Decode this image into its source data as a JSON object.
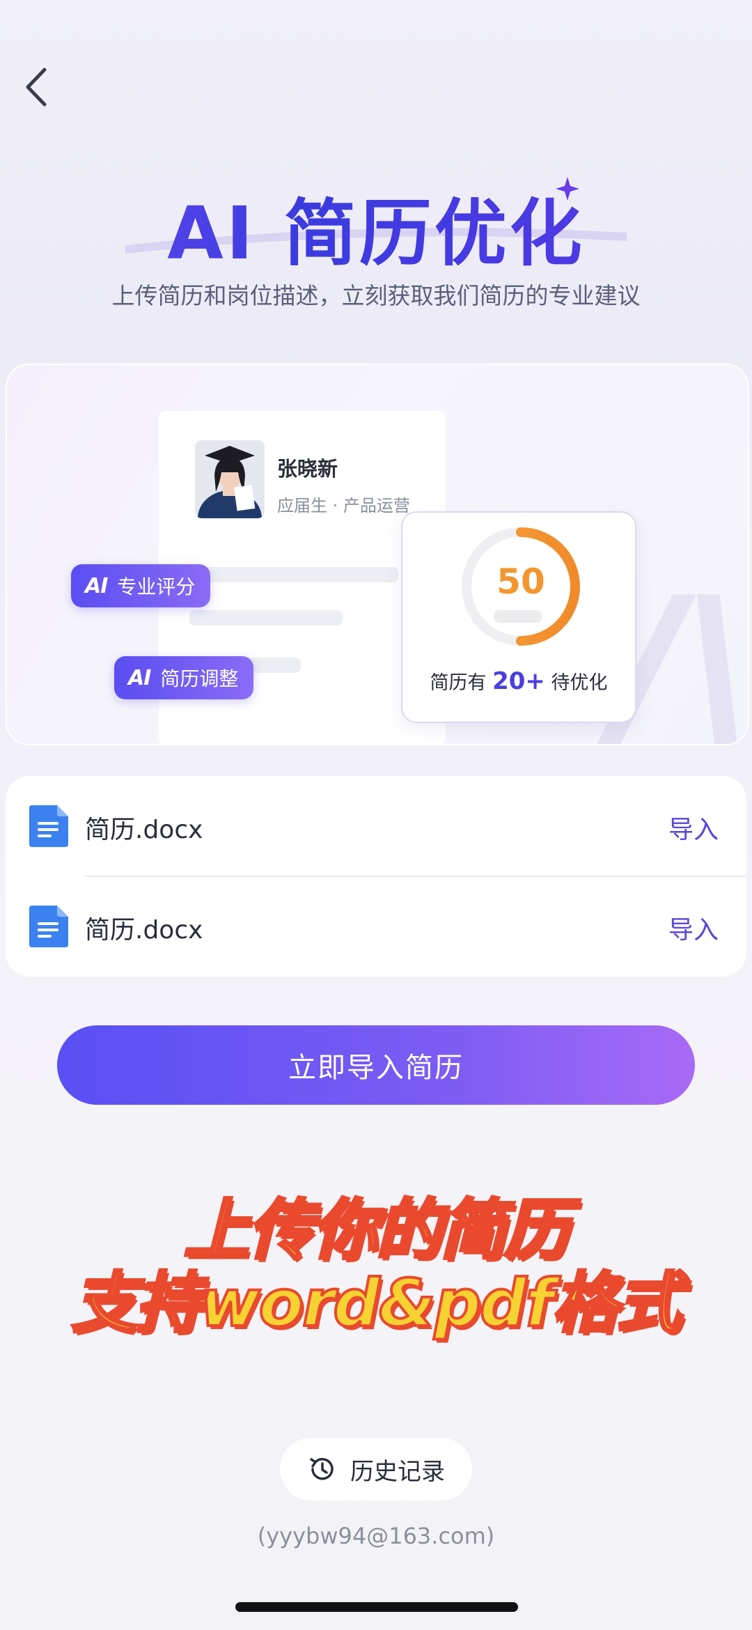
{
  "header": {
    "title_ai": "AI",
    "title_text": "简历优化",
    "subtitle": "上传简历和岗位描述，立刻获取我们简历的专业建议"
  },
  "showcase": {
    "person_name": "张晓新",
    "person_meta": "应届生 · 产品运营",
    "tag_pro_score": "专业评分",
    "tag_adjust": "简历调整",
    "score": "50",
    "score_percent": 50,
    "score_caption_prefix": "简历有",
    "score_caption_count": "20+",
    "score_caption_suffix": "待优化"
  },
  "files": [
    {
      "name": "简历.docx",
      "action": "导入"
    },
    {
      "name": "简历.docx",
      "action": "导入"
    }
  ],
  "primary_button": "立即导入简历",
  "overlay": {
    "line1": "上传你的简历",
    "line2": "支持word&pdf格式"
  },
  "history_button": "历史记录",
  "email": "(yyybw94@163.com)",
  "colors": {
    "accent": "#5a45d8",
    "score_orange": "#f3962f",
    "overlay_yellow": "#f7d233",
    "overlay_red": "#e94a2e"
  }
}
